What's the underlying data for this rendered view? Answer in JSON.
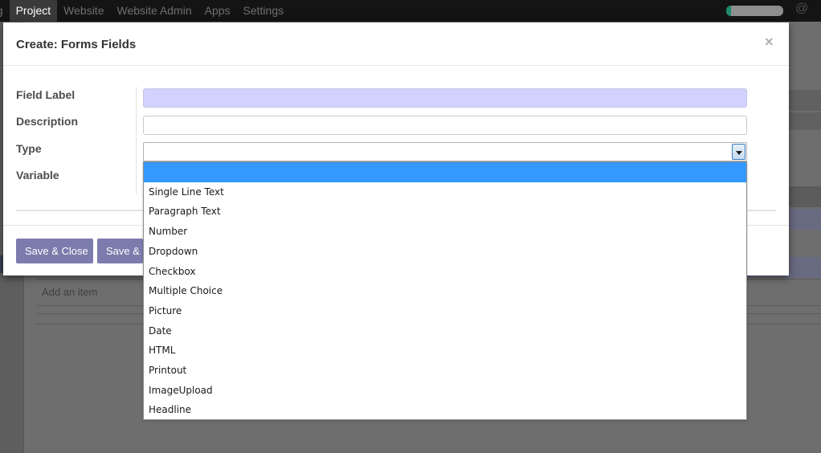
{
  "topbar": {
    "menu": [
      "ng",
      "Project",
      "Website",
      "Website Admin",
      "Apps",
      "Settings"
    ],
    "active": "Project",
    "progress": 0.08
  },
  "background": {
    "add_item": "Add an item"
  },
  "modal": {
    "title": "Create: Forms Fields",
    "close": "×",
    "labels": {
      "field_label": "Field Label",
      "description": "Description",
      "type": "Type",
      "variable": "Variable"
    },
    "values": {
      "field_label": "",
      "description": "",
      "type": ""
    },
    "buttons": {
      "save_close": "Save & Close",
      "save_new": "Save & New"
    }
  },
  "type_options": [
    "",
    "Single Line Text",
    "Paragraph Text",
    "Number",
    "Dropdown",
    "Checkbox",
    "Multiple Choice",
    "Picture",
    "Date",
    "HTML",
    "Printout",
    "ImageUpload",
    "Headline"
  ],
  "selected_option_index": 0,
  "colors": {
    "topbar": "#141414",
    "accent_button": "#7c7bad",
    "selection": "#3399ff",
    "field_highlight": "#d2d2ff"
  }
}
